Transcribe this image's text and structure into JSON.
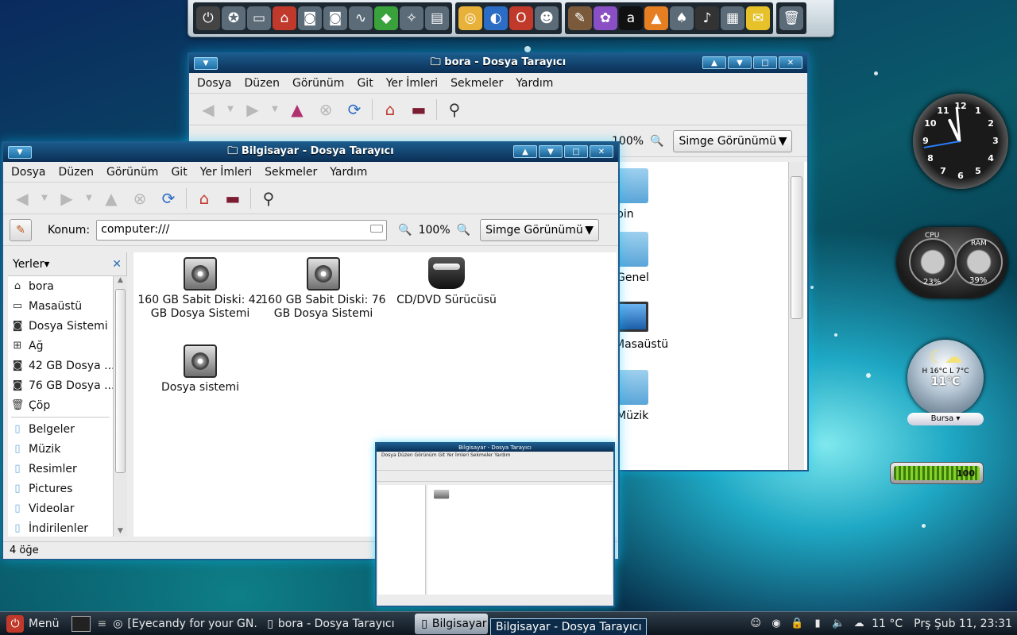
{
  "dock": {
    "icons": [
      "power-icon",
      "ubuntu-icon",
      "monitor-icon",
      "home-icon",
      "hdd-icon",
      "hdd-icon-2",
      "system-monitor-icon",
      "gem-icon",
      "broom-icon",
      "pdf-icon",
      "chrome-icon",
      "firefox-icon",
      "opera-icon",
      "people-icon",
      "gimp-icon",
      "picasa-icon",
      "amazon-icon",
      "vlc-icon",
      "cards-icon",
      "music-icon",
      "calculator-icon",
      "notes-icon",
      "trash-icon"
    ]
  },
  "back_window": {
    "title": "bora - Dosya Tarayıcı",
    "menu": [
      "Dosya",
      "Düzen",
      "Görünüm",
      "Git",
      "Yer İmleri",
      "Sekmeler",
      "Yardım"
    ],
    "location_hint": "",
    "zoom": "100%",
    "view_mode": "Simge Görünümü",
    "items": [
      "bin",
      "Genel",
      "Masaüstü",
      "Müzik"
    ]
  },
  "front_window": {
    "title": "Bilgisayar - Dosya Tarayıcı",
    "menu": [
      "Dosya",
      "Düzen",
      "Görünüm",
      "Git",
      "Yer İmleri",
      "Sekmeler",
      "Yardım"
    ],
    "location_label": "Konum:",
    "location_value": "computer:///",
    "zoom": "100%",
    "view_mode": "Simge Görünümü",
    "sidebar_title": "Yerler",
    "sidebar_items": [
      {
        "label": "bora",
        "icon": "home-icon"
      },
      {
        "label": "Masaüstü",
        "icon": "desktop-icon"
      },
      {
        "label": "Dosya Sistemi",
        "icon": "hdd-icon"
      },
      {
        "label": "Ağ",
        "icon": "network-icon"
      },
      {
        "label": "42 GB Dosya ...",
        "icon": "hdd-icon"
      },
      {
        "label": "76 GB Dosya ...",
        "icon": "hdd-icon"
      },
      {
        "label": "Çöp",
        "icon": "trash-icon"
      },
      {
        "label": "Belgeler",
        "icon": "folder-icon"
      },
      {
        "label": "Müzik",
        "icon": "folder-icon"
      },
      {
        "label": "Resimler",
        "icon": "folder-icon"
      },
      {
        "label": "Pictures",
        "icon": "folder-icon"
      },
      {
        "label": "Videolar",
        "icon": "folder-icon"
      },
      {
        "label": "İndirilenler",
        "icon": "folder-icon"
      }
    ],
    "files": [
      {
        "label": "160 GB Sabit Diski: 42 GB Dosya Sistemi",
        "icon": "hdd-icon"
      },
      {
        "label": "160 GB Sabit Diski: 76 GB Dosya Sistemi",
        "icon": "hdd-icon"
      },
      {
        "label": "CD/DVD Sürücüsü",
        "icon": "cdrom-icon"
      },
      {
        "label": "Dosya sistemi",
        "icon": "hdd-icon"
      }
    ],
    "status": "4 öğe"
  },
  "preview": {
    "title": "Bilgisayar - Dosya Tarayıcı"
  },
  "gadgets": {
    "clock_numbers": [
      "12",
      "1",
      "2",
      "3",
      "4",
      "5",
      "6",
      "7",
      "8",
      "9",
      "10",
      "11"
    ],
    "cpu_label": "CPU",
    "ram_label": "RAM",
    "cpu_value": "23%",
    "ram_value": "39%",
    "weather_hilo": "H 16°C L 7°C",
    "weather_temp": "11°C",
    "weather_city": "Bursa",
    "battery": "100"
  },
  "taskbar": {
    "menu_label": "Menü",
    "tasks": [
      {
        "label": "[Eyecandy for your GN...",
        "icon": "chrome-icon"
      },
      {
        "label": "bora - Dosya Tarayıcı",
        "icon": "folder-icon"
      },
      {
        "label": "Bilgisayar",
        "icon": "folder-icon"
      }
    ],
    "tooltip": "Bilgisayar - Dosya Tarayıcı",
    "temp": "11 °C",
    "datetime": "Prş Şub 11, 23:31"
  },
  "colors": {
    "accent": "#1d5c8e",
    "titlebar": "#0b2f55"
  }
}
